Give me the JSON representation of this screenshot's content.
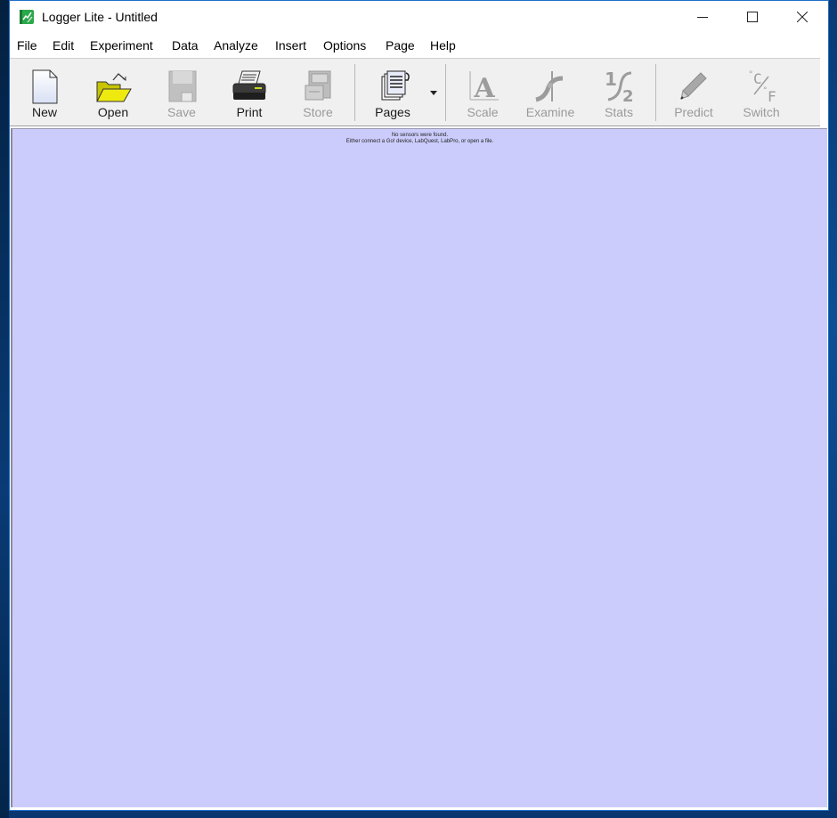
{
  "window": {
    "title": "Logger Lite - Untitled",
    "app_icon": "logger-lite-app-icon",
    "controls": {
      "minimize": "minimize-icon",
      "maximize": "maximize-icon",
      "close": "close-icon"
    }
  },
  "menu": {
    "items": [
      "File",
      "Edit",
      "Experiment",
      "Data",
      "Analyze",
      "Insert",
      "Options",
      "Page",
      "Help"
    ]
  },
  "toolbar": {
    "buttons": [
      {
        "label": "New",
        "icon": "new-document-icon",
        "enabled": true
      },
      {
        "label": "Open",
        "icon": "open-folder-icon",
        "enabled": true
      },
      {
        "label": "Save",
        "icon": "save-disk-icon",
        "enabled": false
      },
      {
        "label": "Print",
        "icon": "printer-icon",
        "enabled": true
      },
      {
        "label": "Store",
        "icon": "file-cabinet-icon",
        "enabled": false
      },
      {
        "label": "Pages",
        "icon": "pages-icon",
        "enabled": true,
        "has_dropdown": true
      },
      {
        "label": "Scale",
        "icon": "autoscale-icon",
        "enabled": false
      },
      {
        "label": "Examine",
        "icon": "examine-icon",
        "enabled": false
      },
      {
        "label": "Stats",
        "icon": "statistics-icon",
        "enabled": false
      },
      {
        "label": "Predict",
        "icon": "pencil-icon",
        "enabled": false
      },
      {
        "label": "Switch",
        "icon": "celsius-fahrenheit-icon",
        "enabled": false
      }
    ]
  },
  "content": {
    "background_color": "#ccccfc",
    "message_line1": "No sensors were found.",
    "message_line2": "Either connect a Go! device, LabQuest, LabPro, or open a file."
  }
}
